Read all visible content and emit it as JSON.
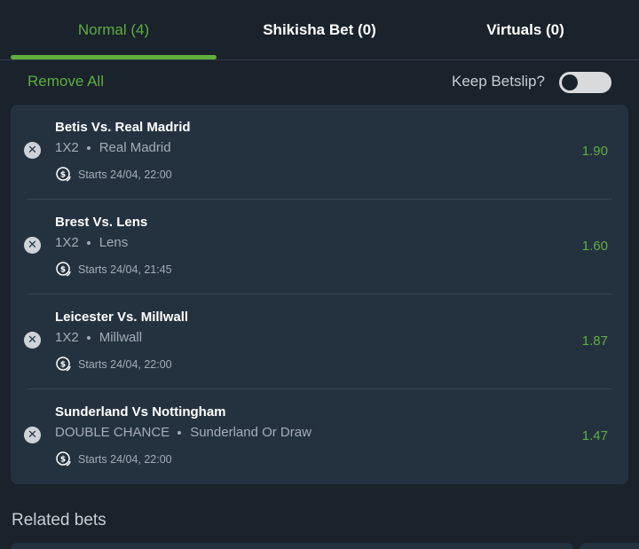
{
  "tabs": [
    {
      "label": "Normal (4)",
      "active": true
    },
    {
      "label": "Shikisha Bet (0)",
      "active": false
    },
    {
      "label": "Virtuals (0)",
      "active": false
    }
  ],
  "controls": {
    "remove_all": "Remove All",
    "keep_betslip_label": "Keep Betslip?",
    "keep_betslip_on": false
  },
  "bets": [
    {
      "match": "Betis Vs. Real Madrid",
      "market": "1X2",
      "selection": "Real Madrid",
      "starts": "Starts 24/04, 22:00",
      "odds": "1.90"
    },
    {
      "match": "Brest Vs. Lens",
      "market": "1X2",
      "selection": "Lens",
      "starts": "Starts 24/04, 21:45",
      "odds": "1.60"
    },
    {
      "match": "Leicester Vs. Millwall",
      "market": "1X2",
      "selection": "Millwall",
      "starts": "Starts 24/04, 22:00",
      "odds": "1.87"
    },
    {
      "match": "Sunderland Vs Nottingham",
      "market": "DOUBLE CHANCE",
      "selection": "Sunderland Or Draw",
      "starts": "Starts 24/04, 22:00",
      "odds": "1.47"
    }
  ],
  "related": {
    "title": "Related bets"
  },
  "colors": {
    "accent": "#5fae3e",
    "background": "#1a222c",
    "card": "#243240"
  }
}
